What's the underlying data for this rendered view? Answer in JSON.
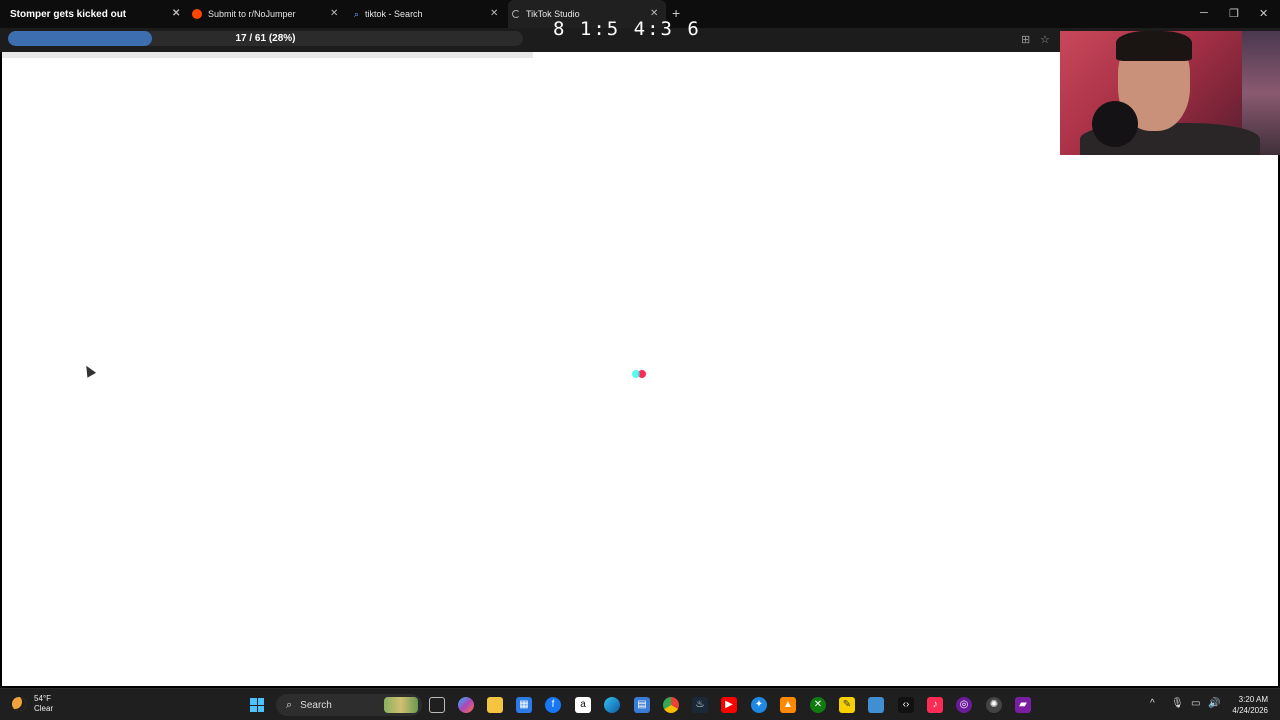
{
  "browser": {
    "tabs": [
      {
        "label": "Stomper gets kicked out",
        "active": false
      },
      {
        "label": "Submit to r/NoJumper",
        "active": false
      },
      {
        "label": "tiktok - Search",
        "active": false
      },
      {
        "label": "TikTok Studio",
        "active": true
      }
    ],
    "new_tab_icon": "plus-icon",
    "window_controls": [
      "minimize-icon",
      "restore-icon",
      "close-icon"
    ]
  },
  "progress": {
    "text": "17 / 61 (28%)",
    "current": 17,
    "total": 61,
    "fraction": 0.28,
    "fill_color": "#3d6fb0"
  },
  "timer": {
    "text": "8 1:5 4:3 6"
  },
  "page": {
    "loader_colors": [
      "#25f4ee",
      "#fe2c55"
    ]
  },
  "taskbar": {
    "weather": {
      "temp": "54°F",
      "condition": "Clear"
    },
    "search_label": "Search",
    "pinned_apps": [
      "task-view-icon",
      "copilot-icon",
      "file-explorer-icon",
      "store-icon",
      "facebook-icon",
      "amazon-icon",
      "edge-icon",
      "calculator-icon",
      "chrome-icon",
      "steam-icon",
      "youtube-icon",
      "app-icon",
      "vlc-icon",
      "xbox-icon",
      "sticky-notes-icon",
      "app-icon",
      "code-icon",
      "tiktok-icon",
      "app-icon",
      "chatgpt-icon",
      "clapper-icon"
    ],
    "clock": {
      "time": "3:20 AM",
      "date": "4/24/2026"
    }
  }
}
